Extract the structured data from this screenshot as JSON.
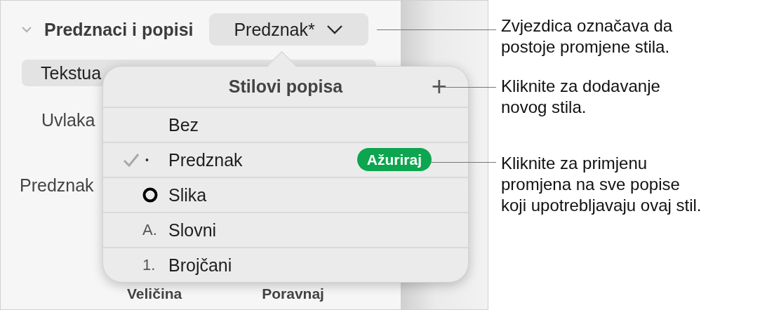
{
  "panel": {
    "section_title": "Predznaci i popisi",
    "expanded": true,
    "style_button": "Predznak*",
    "segment_label": "Tekstua",
    "indent_label": "Uvlaka",
    "bullet_label": "Predznak",
    "bottom_labels": [
      "Veličina",
      "Poravnaj"
    ]
  },
  "popover": {
    "title": "Stilovi popisa",
    "add_label": "+",
    "items": [
      {
        "kind": "none",
        "label": "Bez",
        "selected": false
      },
      {
        "kind": "bullet",
        "marker": "•",
        "label": "Predznak",
        "selected": true,
        "update_label": "Ažuriraj"
      },
      {
        "kind": "image",
        "label": "Slika",
        "selected": false
      },
      {
        "kind": "letter",
        "marker": "A.",
        "label": "Slovni",
        "selected": false
      },
      {
        "kind": "number",
        "marker": "1.",
        "label": "Brojčani",
        "selected": false
      }
    ]
  },
  "callouts": [
    {
      "lines": [
        "Zvjezdica označava da",
        "postoje promjene stila."
      ]
    },
    {
      "lines": [
        "Kliknite za dodavanje",
        "novog stila."
      ]
    },
    {
      "lines": [
        "Kliknite za primjenu",
        "promjena na sve popise",
        "koji upotrebljavaju ovaj stil."
      ]
    }
  ]
}
